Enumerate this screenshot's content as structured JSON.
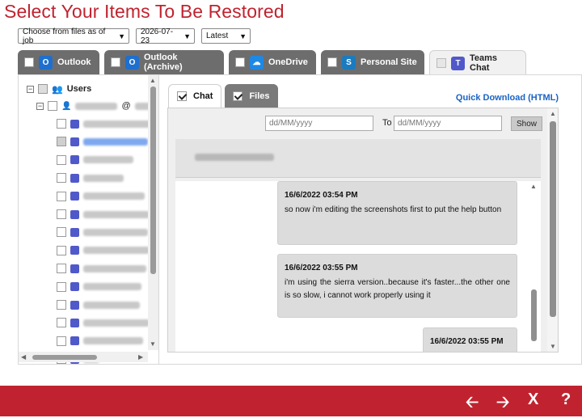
{
  "page_title": "Select Your Items To Be Restored",
  "filters": {
    "mode": "Choose from files as of job",
    "date": "2026-07-23",
    "version": "Latest"
  },
  "tabs": [
    {
      "label": "Outlook",
      "icon": "outlook-icon",
      "color": "#1f6fce"
    },
    {
      "label": "Outlook (Archive)",
      "icon": "outlook-archive-icon",
      "color": "#1f6fce"
    },
    {
      "label": "OneDrive",
      "icon": "onedrive-icon",
      "color": "#1e88e5"
    },
    {
      "label": "Personal Site",
      "icon": "sharepoint-icon",
      "color": "#1a7bbf"
    },
    {
      "label": "Teams Chat",
      "icon": "teams-icon",
      "color": "#5059c9"
    }
  ],
  "tree": {
    "root_label": "Users",
    "user_suffix": "@"
  },
  "subtabs": {
    "chat": "Chat",
    "files": "Files"
  },
  "quick_download": "Quick Download (HTML)",
  "date_filter": {
    "from_placeholder": "dd/MM/yyyy",
    "to_label": "To",
    "to_placeholder": "dd/MM/yyyy",
    "show_label": "Show"
  },
  "messages": [
    {
      "timestamp": "16/6/2022 03:54 PM",
      "text": "so now i'm editing the screenshots first to put the help button"
    },
    {
      "timestamp": "16/6/2022 03:55 PM",
      "text": "i'm using the sierra version..because it's faster...the other one is so slow, i cannot work properly using it"
    },
    {
      "timestamp": "16/6/2022 03:55 PM",
      "text": ""
    }
  ],
  "footer": {
    "back": "🡠",
    "next": "🡢",
    "close": "X",
    "help": "?"
  },
  "colors": {
    "brand_red": "#c0232f",
    "link_blue": "#1a63c4",
    "tab_gray": "#6d6d6d"
  }
}
